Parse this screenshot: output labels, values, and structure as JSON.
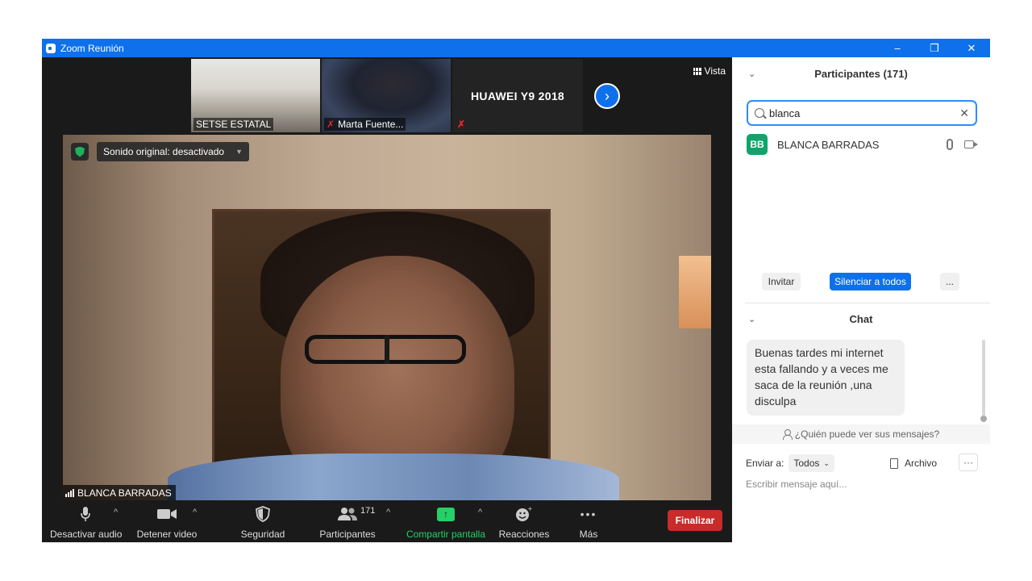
{
  "window": {
    "title": "Zoom Reunión",
    "controls": [
      "–",
      "❐",
      "✕"
    ]
  },
  "thumbnails": [
    {
      "label": "SETSE ESTATAL"
    },
    {
      "label": "Marta Fuente..."
    },
    {
      "label": "HUAWEI Y9 2018"
    }
  ],
  "view_button": {
    "label": "Vista"
  },
  "main_video": {
    "sound_label": "Sonido original: desactivado",
    "name": "BLANCA BARRADAS"
  },
  "toolbar": {
    "audio": "Desactivar audio",
    "video": "Detener video",
    "security": "Seguridad",
    "participants": "Participantes",
    "participants_count": "171",
    "share": "Compartir pantalla",
    "reactions": "Reacciones",
    "more": "Más",
    "end": "Finalizar",
    "share_color": "#24d167",
    "end_color": "#c92a2a"
  },
  "participants_panel": {
    "title": "Participantes (171)",
    "search_value": "blanca",
    "results": [
      {
        "initials": "BB",
        "name": "BLANCA BARRADAS"
      }
    ],
    "invite": "Invitar",
    "mute_all": "Silenciar a todos",
    "more": "..."
  },
  "chat": {
    "title": "Chat",
    "messages": [
      {
        "text": "Buenas tardes mi internet esta fallando y a veces me saca de la reunión ,una disculpa"
      }
    ],
    "who_can_see": "¿Quién puede ver sus mensajes?",
    "send_to_label": "Enviar a:",
    "send_to_value": "Todos",
    "file_label": "Archivo",
    "input_placeholder": "Escribir mensaje aquí..."
  }
}
